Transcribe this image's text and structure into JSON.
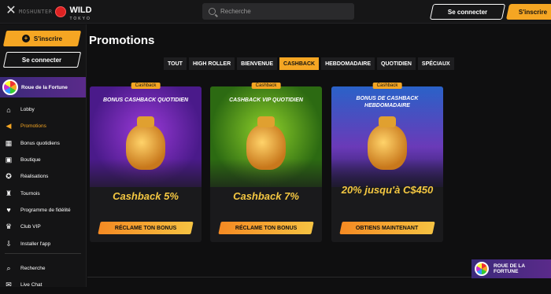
{
  "header": {
    "brand_faded": "MOSHUNTER",
    "brand_wild": "WILD",
    "brand_tokyo": "TOKYO",
    "search_placeholder": "Recherche",
    "login_label": "Se connecter",
    "signup_label": "S'inscrire"
  },
  "sidebar": {
    "signup_label": "S'inscrire",
    "login_label": "Se connecter",
    "wheel_label": "Roue de la Fortune",
    "items": [
      {
        "label": "Lobby",
        "icon": "home-icon",
        "active": false
      },
      {
        "label": "Promotions",
        "icon": "megaphone-icon",
        "active": true
      },
      {
        "label": "Bonus quotidiens",
        "icon": "calendar-icon",
        "active": false
      },
      {
        "label": "Boutique",
        "icon": "cart-icon",
        "active": false
      },
      {
        "label": "Réalisations",
        "icon": "medal-icon",
        "active": false
      },
      {
        "label": "Tournois",
        "icon": "trophy-icon",
        "active": false
      },
      {
        "label": "Programme de fidélité",
        "icon": "heart-icon",
        "active": false
      },
      {
        "label": "Club VIP",
        "icon": "crown-icon",
        "active": false
      },
      {
        "label": "Installer l'app",
        "icon": "download-icon",
        "active": false
      }
    ],
    "bottom_items": [
      {
        "label": "Recherche",
        "icon": "search-icon"
      },
      {
        "label": "Live Chat",
        "icon": "chat-icon"
      }
    ]
  },
  "main": {
    "title": "Promotions",
    "tabs": [
      "TOUT",
      "HIGH ROLLER",
      "BIENVENUE",
      "CASHBACK",
      "HEBDOMADAIRE",
      "QUOTIDIEN",
      "SPÉCIAUX"
    ],
    "active_tab": "CASHBACK",
    "cards": [
      {
        "badge": "Cashback",
        "title": "BONUS CASHBACK QUOTIDIEN",
        "value": "Cashback 5%",
        "button": "RÉCLAME TON BONUS"
      },
      {
        "badge": "Cashback",
        "title": "CASHBACK VIP QUOTIDIEN",
        "value": "Cashback 7%",
        "button": "RÉCLAME TON BONUS"
      },
      {
        "badge": "Cashback",
        "title": "BONUS DE CASHBACK HEBDOMADAIRE",
        "value": "20% jusqu'à C$450",
        "button": "OBTIENS MAINTENANT"
      }
    ]
  },
  "wheel_promo": {
    "label": "ROUE DE LA FORTUNE"
  },
  "colors": {
    "accent": "#f5a623",
    "background": "#0f0f10",
    "value_text": "#f5c842"
  }
}
